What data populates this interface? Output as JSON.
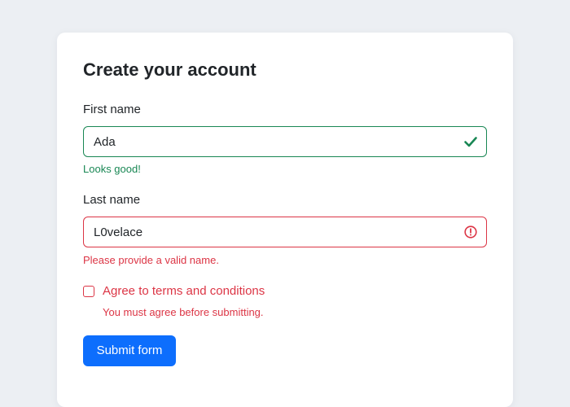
{
  "form": {
    "title": "Create your account",
    "first_name": {
      "label": "First name",
      "value": "Ada",
      "status": "valid",
      "feedback": "Looks good!"
    },
    "last_name": {
      "label": "Last name",
      "value": "L0velace",
      "status": "invalid",
      "feedback": "Please provide a valid name."
    },
    "terms": {
      "label": "Agree to terms and conditions",
      "checked": false,
      "feedback": "You must agree before submitting."
    },
    "submit_label": "Submit form"
  },
  "colors": {
    "valid": "#198754",
    "invalid": "#dc3545",
    "primary": "#0d6efd",
    "page_background": "#eceff3"
  },
  "icons": {
    "valid": "check-icon",
    "invalid": "exclamation-circle-icon"
  }
}
